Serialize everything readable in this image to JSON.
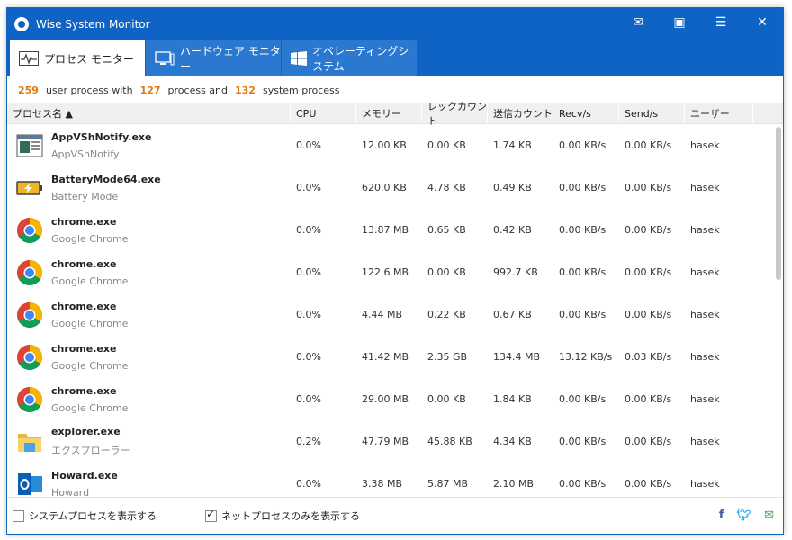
{
  "window": {
    "title": "Wise System Monitor"
  },
  "tabs": [
    {
      "label": "プロセス モニター",
      "icon": "pulse-monitor-icon"
    },
    {
      "label": "ハードウェア モニター",
      "icon": "computer-monitor-icon"
    },
    {
      "label": "オペレーティングシステム",
      "icon": "windows-logo-icon"
    }
  ],
  "summary": {
    "user_count": "259",
    "user_text": "user process with",
    "process_count": "127",
    "process_text": "process and",
    "system_count": "132",
    "system_text": "system process"
  },
  "columns": [
    "プロセス名 ▲",
    "CPU",
    "メモリー",
    "レックカウント",
    "送信カウント",
    "Recv/s",
    "Send/s",
    "ユーザー"
  ],
  "rows": [
    {
      "exe": "AppVShNotify.exe",
      "desc": "AppVShNotify",
      "cpu": "0.0%",
      "mem": "12.00 KB",
      "recv_count": "0.00 KB",
      "send_count": "1.74 KB",
      "recv": "0.00 KB/s",
      "send": "0.00 KB/s",
      "user": "hasek",
      "icon": "appvsh-icon"
    },
    {
      "exe": "BatteryMode64.exe",
      "desc": "Battery Mode",
      "cpu": "0.0%",
      "mem": "620.0 KB",
      "recv_count": "4.78 KB",
      "send_count": "0.49 KB",
      "recv": "0.00 KB/s",
      "send": "0.00 KB/s",
      "user": "hasek",
      "icon": "battery-icon"
    },
    {
      "exe": "chrome.exe",
      "desc": "Google Chrome",
      "cpu": "0.0%",
      "mem": "13.87 MB",
      "recv_count": "0.65 KB",
      "send_count": "0.42 KB",
      "recv": "0.00 KB/s",
      "send": "0.00 KB/s",
      "user": "hasek",
      "icon": "chrome-icon"
    },
    {
      "exe": "chrome.exe",
      "desc": "Google Chrome",
      "cpu": "0.0%",
      "mem": "122.6 MB",
      "recv_count": "0.00 KB",
      "send_count": "992.7 KB",
      "recv": "0.00 KB/s",
      "send": "0.00 KB/s",
      "user": "hasek",
      "icon": "chrome-icon"
    },
    {
      "exe": "chrome.exe",
      "desc": "Google Chrome",
      "cpu": "0.0%",
      "mem": "4.44 MB",
      "recv_count": "0.22 KB",
      "send_count": "0.67 KB",
      "recv": "0.00 KB/s",
      "send": "0.00 KB/s",
      "user": "hasek",
      "icon": "chrome-icon"
    },
    {
      "exe": "chrome.exe",
      "desc": "Google Chrome",
      "cpu": "0.0%",
      "mem": "41.42 MB",
      "recv_count": "2.35 GB",
      "send_count": "134.4 MB",
      "recv": "13.12 KB/s",
      "send": "0.03 KB/s",
      "user": "hasek",
      "icon": "chrome-icon"
    },
    {
      "exe": "chrome.exe",
      "desc": "Google Chrome",
      "cpu": "0.0%",
      "mem": "29.00 MB",
      "recv_count": "0.00 KB",
      "send_count": "1.84 KB",
      "recv": "0.00 KB/s",
      "send": "0.00 KB/s",
      "user": "hasek",
      "icon": "chrome-icon"
    },
    {
      "exe": "explorer.exe",
      "desc": "エクスプローラー",
      "cpu": "0.2%",
      "mem": "47.79 MB",
      "recv_count": "45.88 KB",
      "send_count": "4.34 KB",
      "recv": "0.00 KB/s",
      "send": "0.00 KB/s",
      "user": "hasek",
      "icon": "folder-icon"
    },
    {
      "exe": "Howard.exe",
      "desc": "Howard",
      "cpu": "0.0%",
      "mem": "3.38 MB",
      "recv_count": "5.87 MB",
      "send_count": "2.10 MB",
      "recv": "0.00 KB/s",
      "send": "0.00 KB/s",
      "user": "hasek",
      "icon": "outlook-icon"
    }
  ],
  "footer": {
    "show_system": {
      "label": "システムプロセスを表示する",
      "checked": false
    },
    "show_net": {
      "label": "ネットプロセスのみを表示する",
      "checked": true
    }
  },
  "colors": {
    "titlebar": "#0f63c4",
    "accent_number": "#e07a10"
  }
}
